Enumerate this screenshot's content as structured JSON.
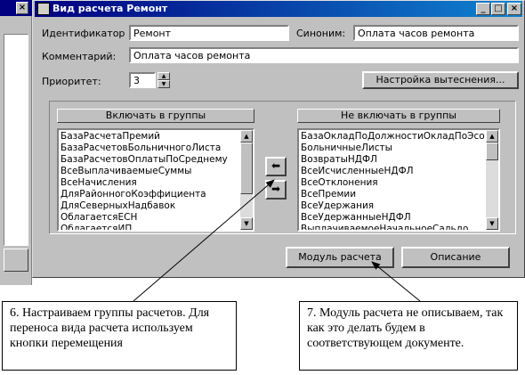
{
  "dialog": {
    "title": "Вид расчета Ремонт",
    "window_buttons": {
      "minimize": "_",
      "maximize": "□",
      "close": "×"
    }
  },
  "form": {
    "identifier_label": "Идентификатор",
    "identifier_value": "Ремонт",
    "synonym_label": "Синоним:",
    "synonym_value": "Оплата часов ремонта",
    "comment_label": "Комментарий:",
    "comment_value": "Оплата часов ремонта",
    "priority_label": "Приоритет:",
    "priority_value": "3",
    "exclusion_settings_label": "Настройка вытеснения..."
  },
  "groups": {
    "include_header": "Включать в группы",
    "exclude_header": "Не включать в группы",
    "include_items": [
      "БазаРасчетаПремий",
      "БазаРасчетовБольничногоЛиста",
      "БазаРасчетовОплатыПоСреднему",
      "ВсеВыплачиваемыеСуммы",
      "ВсеНачисления",
      "ДляРайонногоКоэффициента",
      "ДляСеверныхНадбавок",
      "ОблагаетсяЕСН",
      "ОблагаетсяИП"
    ],
    "exclude_items": [
      "БазаОкладПоДолжностиОкладПоЭсо",
      "БольничныеЛисты",
      "ВозвратыНДФЛ",
      "ВсеИсчисленныеНДФЛ",
      "ВсеОтклонения",
      "ВсеПремии",
      "ВсеУдержания",
      "ВсеУдержанныеНДФЛ",
      "ВыплачиваемоеНачальноеСальдо"
    ],
    "move_left_glyph": "⬅",
    "move_right_glyph": "➡"
  },
  "buttons": {
    "module_label": "Модуль расчета",
    "description_label": "Описание"
  },
  "callouts": {
    "note6": "6. Настраиваем группы расчетов. Для переноса вида расчета используем кнопки перемещения",
    "note7": "7. Модуль расчета не описываем, так как это делать будем в соответствующем документе."
  },
  "colors": {
    "titlebar": "#000080",
    "window_face": "#c0c0c0"
  }
}
